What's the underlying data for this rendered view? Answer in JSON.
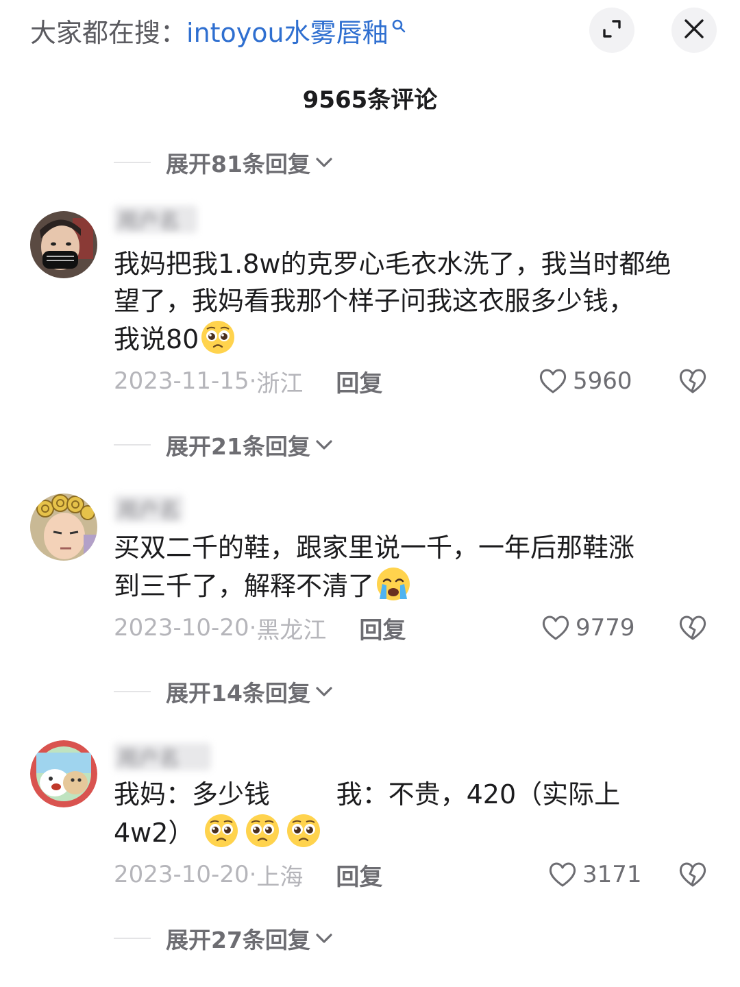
{
  "search_hint": {
    "prefix": "大家都在搜：",
    "keyword": "intoyou水雾唇釉"
  },
  "header": {
    "comment_count": "9565条评论"
  },
  "expand_replies": [
    "展开81条回复",
    "展开21条回复",
    "展开14条回复",
    "展开27条回复"
  ],
  "comments": [
    {
      "username": "用户名",
      "text_lines": [
        "我妈把我1.8w的克罗心毛衣水洗了，我当时都绝",
        "望了，我妈看我那个样子问我这衣服多少钱，",
        "我说80"
      ],
      "emoji": "pleading-face",
      "date": "2023-11-15",
      "location": "浙江",
      "reply_label": "回复",
      "likes": "5960"
    },
    {
      "username": "用户名",
      "text_lines": [
        "买双二千的鞋，跟家里说一千，一年后那鞋涨",
        "到三千了，解释不清了"
      ],
      "emoji": "crying-face",
      "date": "2023-10-20",
      "location": "黑龙江",
      "reply_label": "回复",
      "likes": "9779"
    },
    {
      "username": "用户名",
      "text_lines": [
        "我妈：多少钱        我：不贵，420（实际上",
        "4w2）"
      ],
      "emoji": "pleading-face",
      "date": "2023-10-20",
      "location": "上海",
      "reply_label": "回复",
      "likes": "3171"
    }
  ],
  "colors": {
    "keyword_blue": "#2f6fd0",
    "muted_gray": "#b5b5ba",
    "label_gray": "#6d6d72"
  }
}
